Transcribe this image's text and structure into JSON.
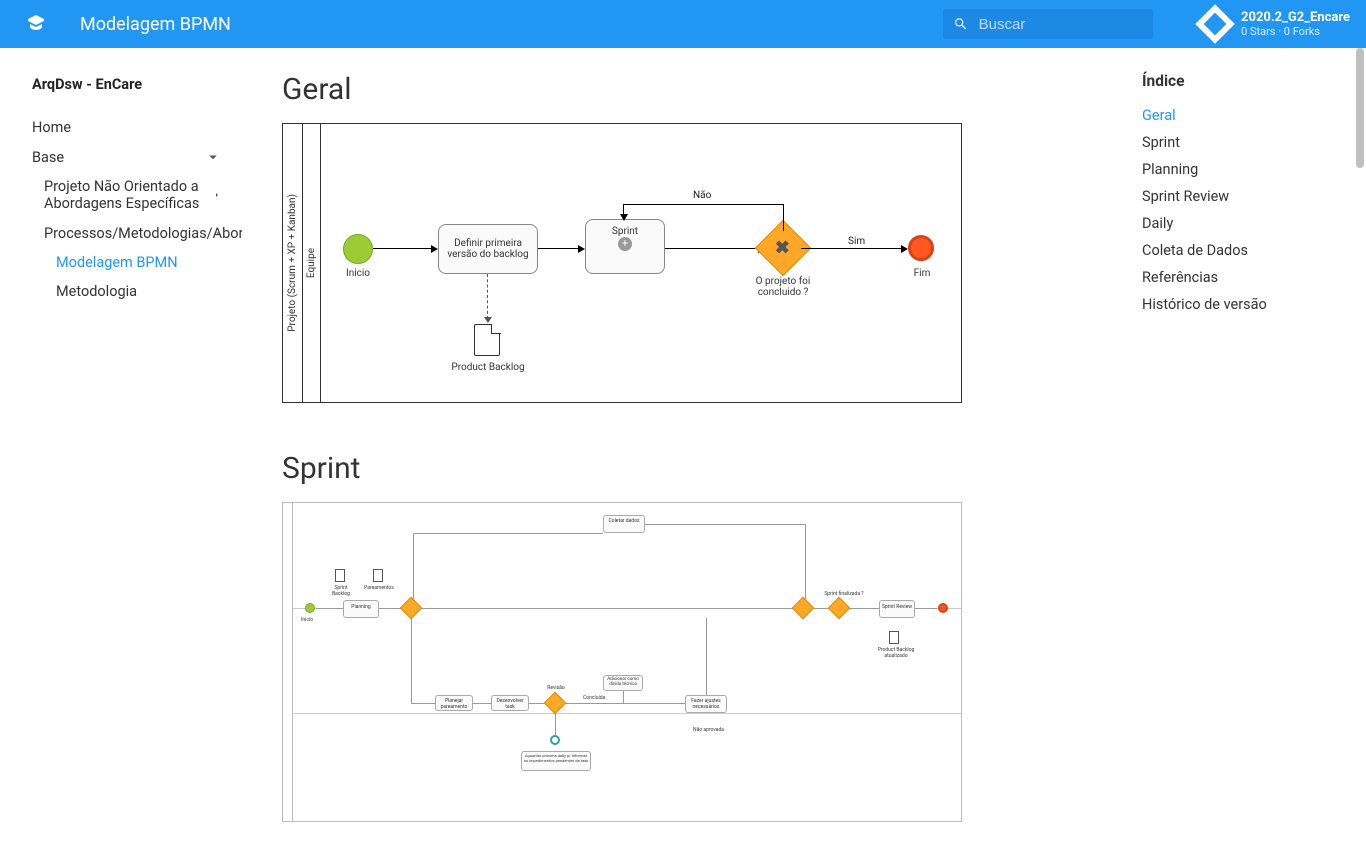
{
  "header": {
    "title": "Modelagem BPMN",
    "search_placeholder": "Buscar",
    "repo_name": "2020.2_G2_Encare",
    "repo_meta": "0 Stars · 0 Forks"
  },
  "sidebar": {
    "project": "ArqDsw - EnCare",
    "home": "Home",
    "base": "Base",
    "projeto": "Projeto Não Orientado a Abordagens Específicas",
    "processos": "Processos/Metodologias/Abordagens",
    "modelagem": "Modelagem BPMN",
    "metodologia": "Metodologia"
  },
  "sections": {
    "geral": "Geral",
    "sprint": "Sprint"
  },
  "toc": {
    "title": "Índice",
    "items": [
      "Geral",
      "Sprint",
      "Planning",
      "Sprint Review",
      "Daily",
      "Coleta de Dados",
      "Referências",
      "Histórico de versão"
    ]
  },
  "geral_diagram": {
    "pool": "Projeto (Scrum + XP + Kanban)",
    "lane": "Equipe",
    "start": "Inicio",
    "task_backlog": "Definir primeira versão do backlog",
    "subprocess_sprint": "Sprint",
    "doc_backlog": "Product Backlog",
    "gateway_question": "O projeto foi concluido ?",
    "flow_no": "Não",
    "flow_yes": "Sim",
    "end": "Fim"
  },
  "sprint_diagram": {
    "labels": {
      "coletar_dados": "Coletar dados",
      "sprint_backlog": "Sprint Backlog",
      "pareamentos": "Pareamentos",
      "planning": "Planning",
      "inicio": "Inicio",
      "sprint_finalizada": "Sprint finalizada ?",
      "sprint_review": "Sprint Review",
      "product_backlog_atualizado": "Product Backlog atualizado",
      "planejar": "Planejar pareamento",
      "desenvolver": "Desenvolver task",
      "revisao": "Revisão",
      "adicionar_divida": "Adicionar como dívida técnica",
      "fazer_ajustes": "Fazer ajustes necessários",
      "concluida": "Concluída",
      "aguardar": "Aguardar próxima daily p/ informar os impedimentos pendentes da task",
      "nao_aprovada": "Não aprovada"
    }
  }
}
